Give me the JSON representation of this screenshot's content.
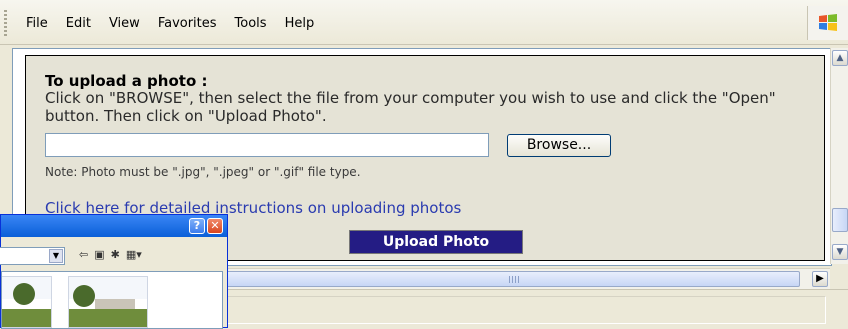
{
  "menu": {
    "items": [
      "File",
      "Edit",
      "View",
      "Favorites",
      "Tools",
      "Help"
    ]
  },
  "upload": {
    "title": "To upload a photo :",
    "instructions": "Click on \"BROWSE\", then select the file from your computer you wish to use and click the \"Open\" button. Then click on \"Upload Photo\".",
    "file_value": "",
    "browse_label": "Browse...",
    "note": "Note: Photo must be \".jpg\", \".jpeg\" or \".gif\" file type.",
    "instructions_link": "Click here for detailed instructions on uploading photos",
    "upload_button_label": "Upload Photo"
  },
  "dialog": {
    "help_label": "?",
    "close_label": "✕",
    "toolbar_icons": [
      "back-icon",
      "up-folder-icon",
      "new-folder-icon",
      "views-menu-icon"
    ]
  },
  "colors": {
    "upload_button_bg": "#241c84",
    "link_color": "#2a3bb0",
    "panel_bg": "#e5e3d6"
  }
}
